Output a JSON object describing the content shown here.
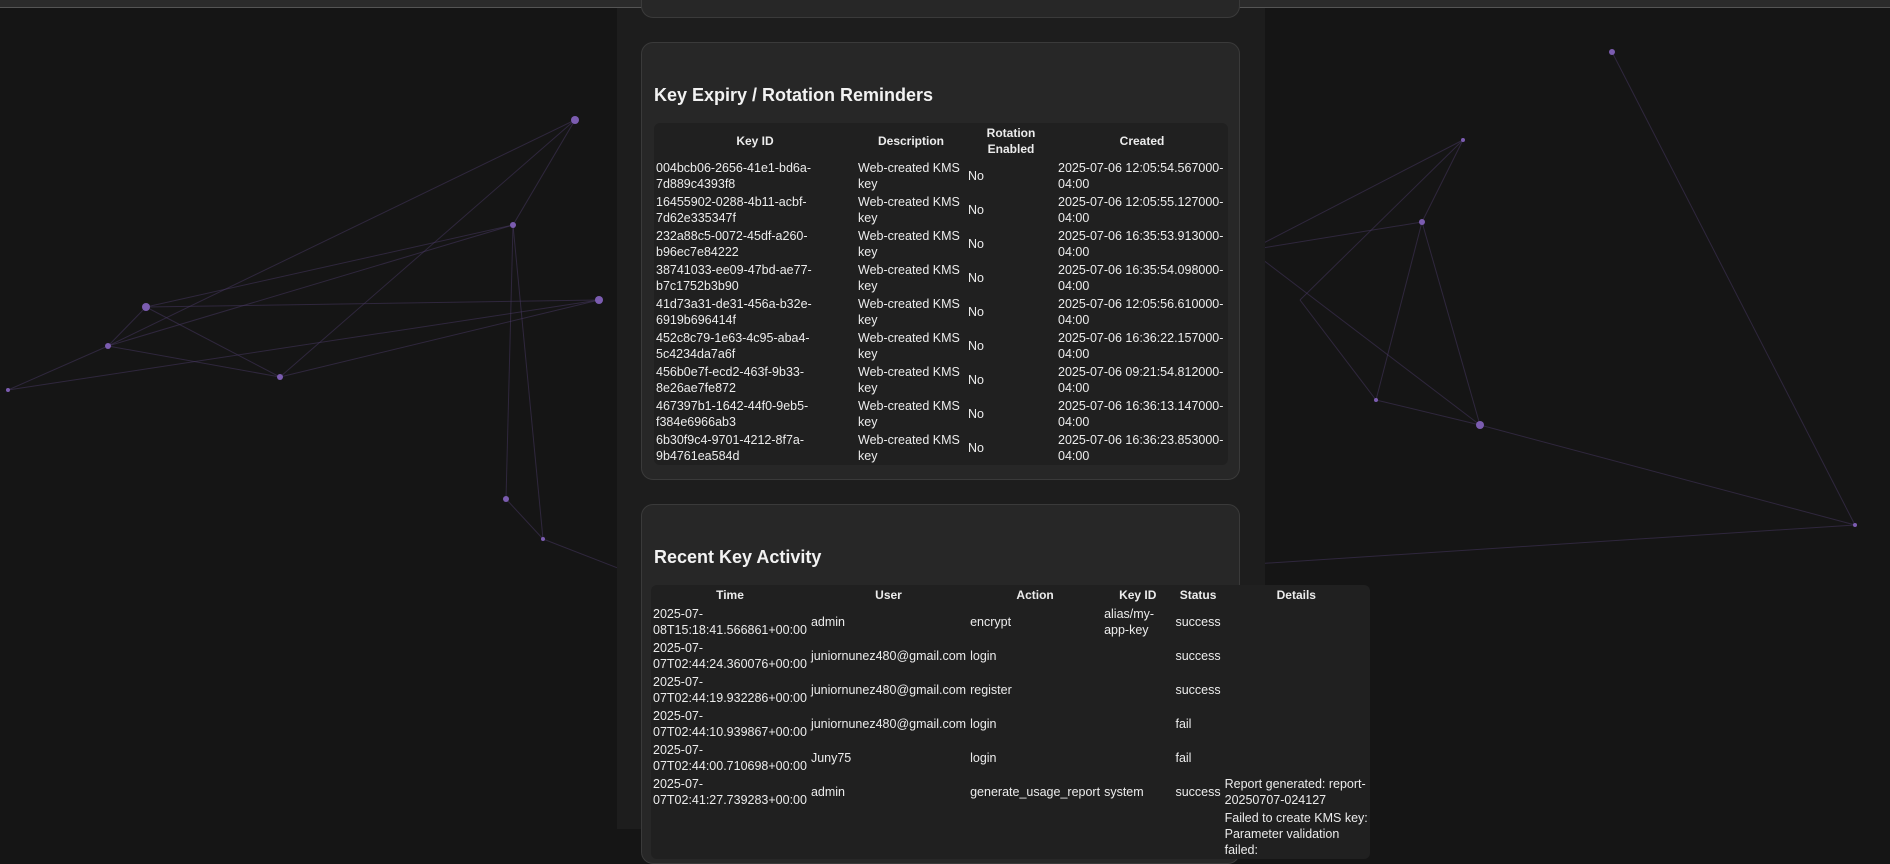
{
  "expiry": {
    "title": "Key Expiry / Rotation Reminders",
    "headers": [
      "Key ID",
      "Description",
      "Rotation Enabled",
      "Created"
    ],
    "rows": [
      [
        "004bcb06-2656-41e1-bd6a-7d889c4393f8",
        "Web-created KMS key",
        "No",
        "2025-07-06 12:05:54.567000-04:00"
      ],
      [
        "16455902-0288-4b11-acbf-7d62e335347f",
        "Web-created KMS key",
        "No",
        "2025-07-06 12:05:55.127000-04:00"
      ],
      [
        "232a88c5-0072-45df-a260-b96ec7e84222",
        "Web-created KMS key",
        "No",
        "2025-07-06 16:35:53.913000-04:00"
      ],
      [
        "38741033-ee09-47bd-ae77-b7c1752b3b90",
        "Web-created KMS key",
        "No",
        "2025-07-06 16:35:54.098000-04:00"
      ],
      [
        "41d73a31-de31-456a-b32e-6919b696414f",
        "Web-created KMS key",
        "No",
        "2025-07-06 12:05:56.610000-04:00"
      ],
      [
        "452c8c79-1e63-4c95-aba4-5c4234da7a6f",
        "Web-created KMS key",
        "No",
        "2025-07-06 16:36:22.157000-04:00"
      ],
      [
        "456b0e7f-ecd2-463f-9b33-8e26ae7fe872",
        "Web-created KMS key",
        "No",
        "2025-07-06 09:21:54.812000-04:00"
      ],
      [
        "467397b1-1642-44f0-9eb5-f384e6966ab3",
        "Web-created KMS key",
        "No",
        "2025-07-06 16:36:13.147000-04:00"
      ],
      [
        "6b30f9c4-9701-4212-8f7a-9b4761ea584d",
        "Web-created KMS key",
        "No",
        "2025-07-06 16:36:23.853000-04:00"
      ]
    ]
  },
  "activity": {
    "title": "Recent Key Activity",
    "headers": [
      "Time",
      "User",
      "Action",
      "Key ID",
      "Status",
      "Details"
    ],
    "rows": [
      [
        "2025-07-08T15:18:41.566861+00:00",
        "admin",
        "encrypt",
        "alias/my-app-key",
        "success",
        ""
      ],
      [
        "2025-07-07T02:44:24.360076+00:00",
        "juniornunez480@gmail.com",
        "login",
        "",
        "success",
        ""
      ],
      [
        "2025-07-07T02:44:19.932286+00:00",
        "juniornunez480@gmail.com",
        "register",
        "",
        "success",
        ""
      ],
      [
        "2025-07-07T02:44:10.939867+00:00",
        "juniornunez480@gmail.com",
        "login",
        "",
        "fail",
        ""
      ],
      [
        "2025-07-07T02:44:00.710698+00:00",
        "Juny75",
        "login",
        "",
        "fail",
        ""
      ],
      [
        "2025-07-07T02:41:27.739283+00:00",
        "admin",
        "generate_usage_report",
        "system",
        "success",
        "Report generated: report-20250707-024127"
      ],
      [
        "",
        "",
        "",
        "",
        "",
        "Failed to create KMS key: Parameter validation failed:"
      ]
    ]
  },
  "colors": {
    "accent": "#7b5cb0",
    "background": "#151515",
    "card": "#272727"
  }
}
